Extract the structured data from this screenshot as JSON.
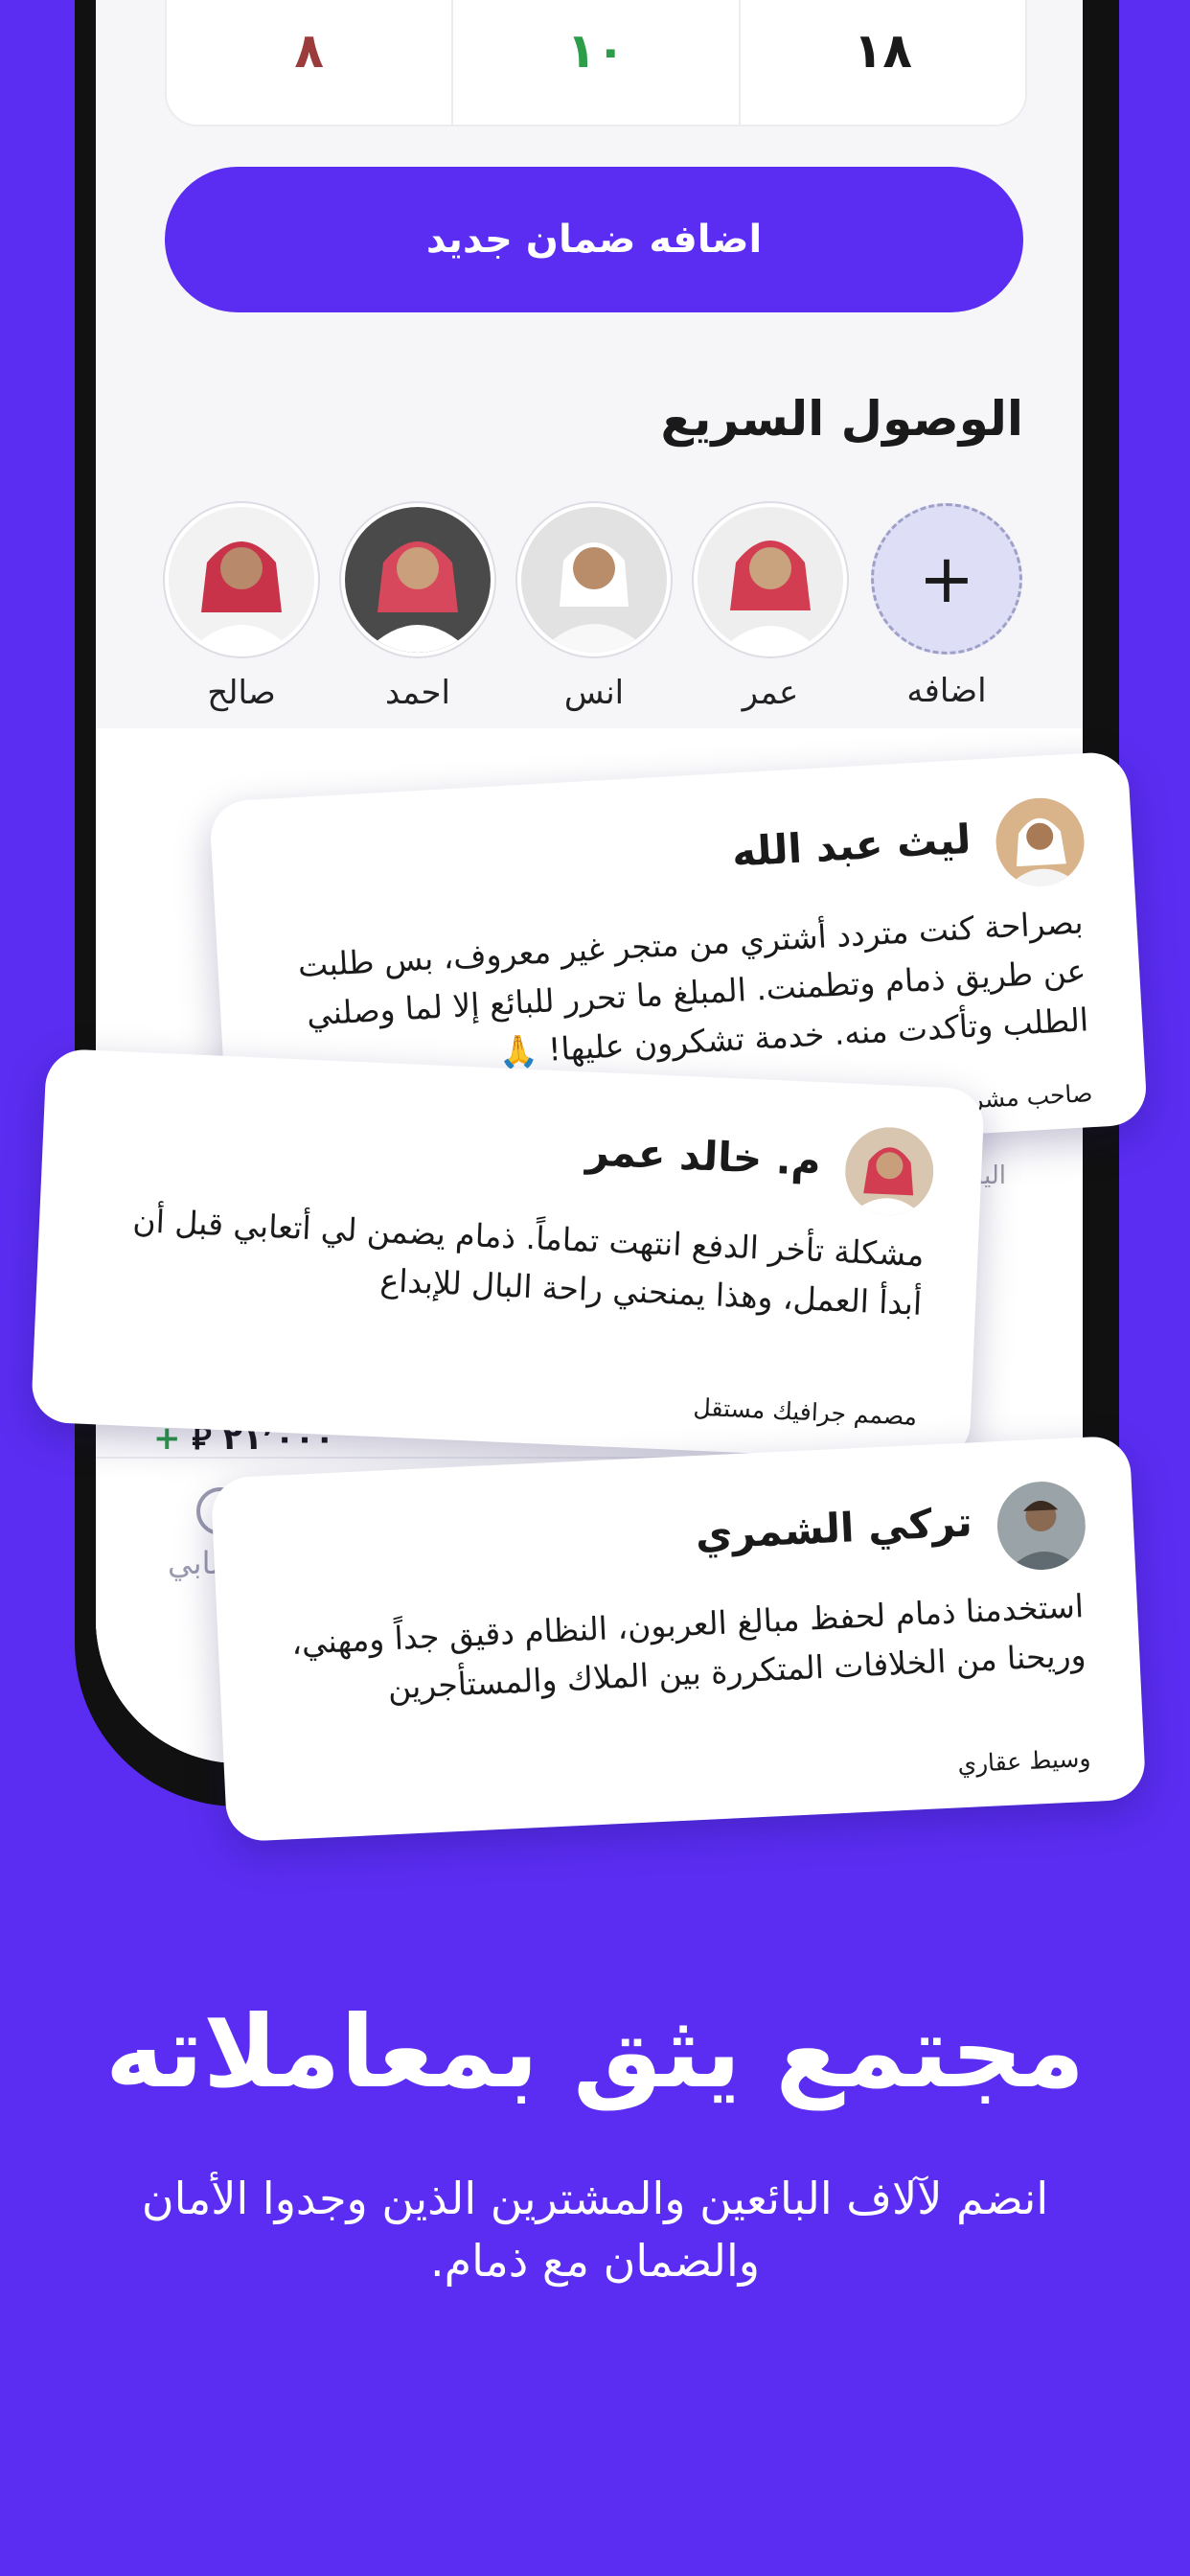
{
  "stats": {
    "left": "٨",
    "middle": "١٠",
    "right": "١٨"
  },
  "add_guarantee_button": "اضافه ضمان جديد",
  "quick_access": {
    "title": "الوصول السريع",
    "add_label": "اضافه",
    "contacts": [
      {
        "name": "عمر"
      },
      {
        "name": "انس"
      },
      {
        "name": "احمد"
      },
      {
        "name": "صالح"
      }
    ]
  },
  "background_peek": {
    "today": "اليوم",
    "amount": "٢١٬٠٠٠",
    "currency_symbol": "⃁",
    "plus": "+",
    "nav_label": "حسابي"
  },
  "testimonials": [
    {
      "name": "ليث عبد الله",
      "body": "بصراحة كنت متردد أشتري من متجر غير معروف، بس طلبت عن طريق ذمام وتطمنت. المبلغ ما تحرر للبائع إلا لما وصلني الطلب وتأكدت منه. خدمة تشكرون عليها! 🙏",
      "role": "صاحب مشروع ناشئ"
    },
    {
      "name": "م. خالد عمر",
      "body": "مشكلة تأخر الدفع انتهت تماماً. ذمام يضمن لي أتعابي قبل أن أبدأ العمل، وهذا يمنحني راحة البال للإبداع",
      "role": "مصمم جرافيك مستقل"
    },
    {
      "name": "تركي الشمري",
      "body": "استخدمنا ذمام لحفظ مبالغ العربون، النظام دقيق جداً ومهني، وريحنا من الخلافات المتكررة بين الملاك والمستأجرين",
      "role": "وسيط عقاري"
    }
  ],
  "hero": {
    "title": "مجتمع يثق بمعاملاته",
    "subtitle": "انضم لآلاف البائعين والمشترين الذين وجدوا الأمان والضمان مع ذمام."
  },
  "colors": {
    "brand": "#5b2df2",
    "stat_red": "#9b3b3b",
    "stat_green": "#2e9d4a"
  }
}
